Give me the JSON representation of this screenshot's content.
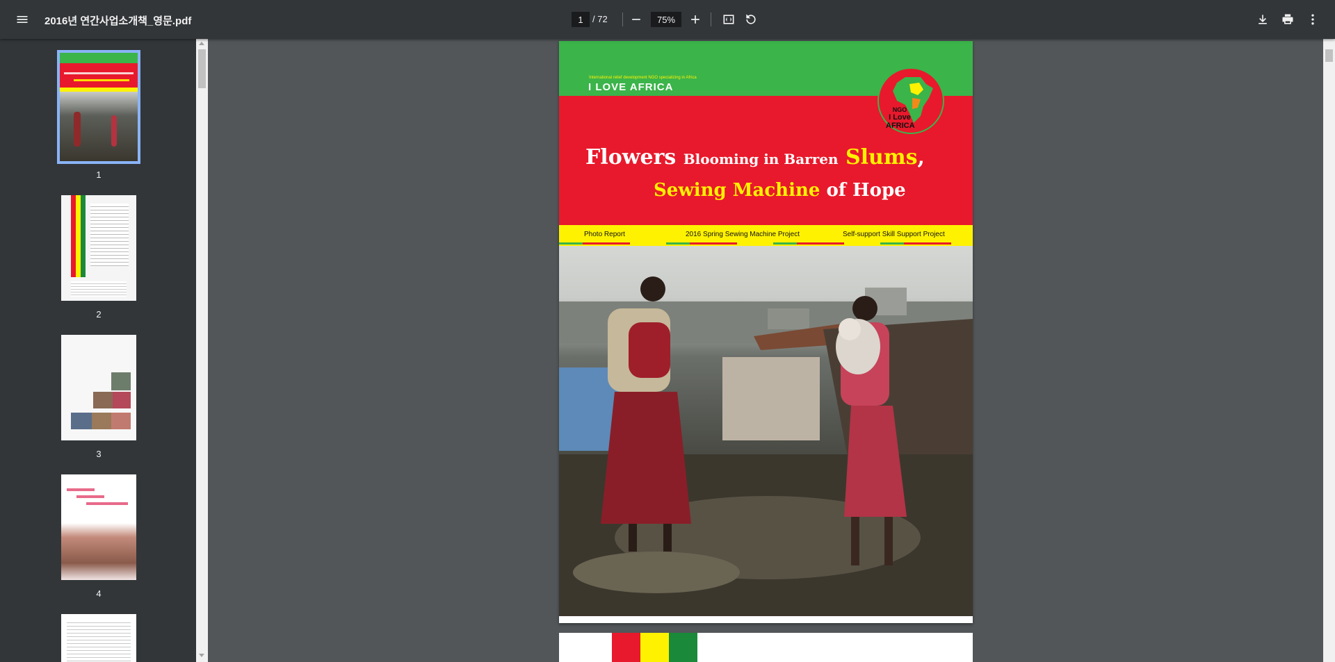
{
  "toolbar": {
    "title": "2016년 연간사업소개책_영문.pdf",
    "current_page": "1",
    "page_total": "/ 72",
    "zoom": "75%"
  },
  "icons": {
    "menu": "menu-icon",
    "zoom_out": "minus-icon",
    "zoom_in": "plus-icon",
    "fit": "fit-page-icon",
    "rotate": "rotate-icon",
    "download": "download-icon",
    "print": "print-icon",
    "more": "more-vert-icon"
  },
  "thumbnails": [
    {
      "label": "1"
    },
    {
      "label": "2"
    },
    {
      "label": "3"
    },
    {
      "label": "4"
    }
  ],
  "page1": {
    "tagline": "International relief development NGO specializing in Africa",
    "brand": "I LOVE AFRICA",
    "logo_lines": [
      "NGO",
      "I Love",
      "AFRICA"
    ],
    "headline_line1_white_a": "Flowers",
    "headline_line1_white_b": "Blooming in Barren",
    "headline_line1_yellow": "Slums",
    "headline_line1_comma": ",",
    "headline_line2_yellow": "Sewing Machine",
    "headline_line2_white": "of Hope",
    "nav": [
      "Photo Report",
      "2016 Spring Sewing Machine Project",
      "Self-support Skill Support Project"
    ]
  },
  "colors": {
    "green": "#3bb44a",
    "red": "#e8192c",
    "yellow": "#fff200",
    "toolbar": "#323639",
    "viewer_bg": "#525659",
    "selected_outline": "#8ab4f8"
  }
}
